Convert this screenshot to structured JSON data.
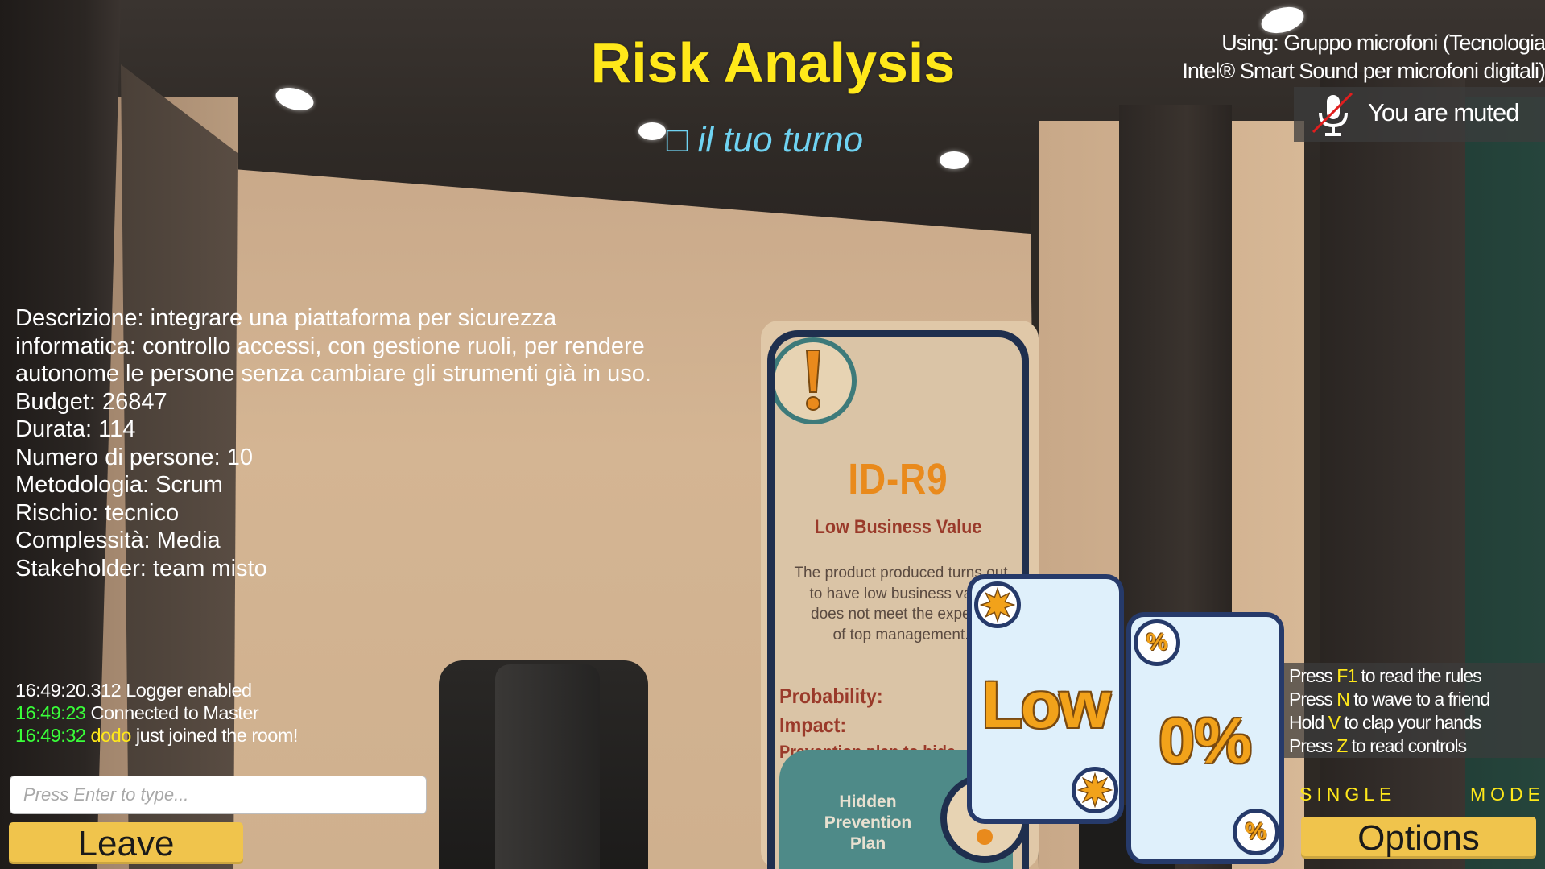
{
  "title": "Risk Analysis",
  "turn_text": "□ il tuo turno",
  "voice": {
    "source_line1": "Using: Gruppo microfoni (Tecnologia",
    "source_line2": "Intel® Smart Sound per microfoni digitali)",
    "muted_label": "You are muted",
    "icon": "mic-muted-icon"
  },
  "project": {
    "lines": [
      "Descrizione: integrare una piattaforma per sicurezza",
      "informatica: controllo accessi, con gestione ruoli, per rendere",
      "autonome le persone senza cambiare gli strumenti già in uso.",
      "Budget: 26847",
      "Durata: 114",
      "Numero di persone: 10",
      "Metodologia: Scrum",
      "Rischio: tecnico",
      "Complessità: Media",
      "Stakeholder: team misto"
    ]
  },
  "log": {
    "line1": "16:49:20.312 Logger enabled",
    "line2_time": "16:49:23",
    "line2_text": " Connected to Master",
    "line3_time": "16:49:32",
    "line3_user": " dodo",
    "line3_text": " just joined the room!"
  },
  "chat": {
    "placeholder": "Press Enter to type..."
  },
  "buttons": {
    "leave": "Leave",
    "options": "Options"
  },
  "controls": {
    "c1_pre": "Press ",
    "c1_key": "F1",
    "c1_post": " to read the rules",
    "c2_pre": "Press ",
    "c2_key": "N",
    "c2_post": " to wave to a friend",
    "c3_pre": "Hold ",
    "c3_key": "V",
    "c3_post": " to clap your hands",
    "c4_pre": "Press ",
    "c4_key": "Z",
    "c4_post": " to read controls"
  },
  "mode": {
    "word1": "SINGLE",
    "word2": "MODE"
  },
  "risk_card": {
    "id": "ID-R9",
    "name": "Low Business Value",
    "desc_lines": [
      "The product produced turns out",
      "to have low business value",
      "does not meet the expecta",
      "of top management."
    ],
    "field_probability": "Probability:",
    "field_impact": "Impact:",
    "field_prevention": "Prevention plan to hide",
    "plan_label_1": "Hidden",
    "plan_label_2": "Prevention",
    "plan_label_3": "Plan"
  },
  "hand_cards": [
    {
      "value": "Low",
      "badge": "sun-icon"
    },
    {
      "value": "0%",
      "badge": "%"
    }
  ],
  "colors": {
    "title": "#ffe81a",
    "turn": "#6fd3f2",
    "log_time": "#39ff39",
    "highlight": "#ffe81a",
    "button": "#f0c44c"
  }
}
